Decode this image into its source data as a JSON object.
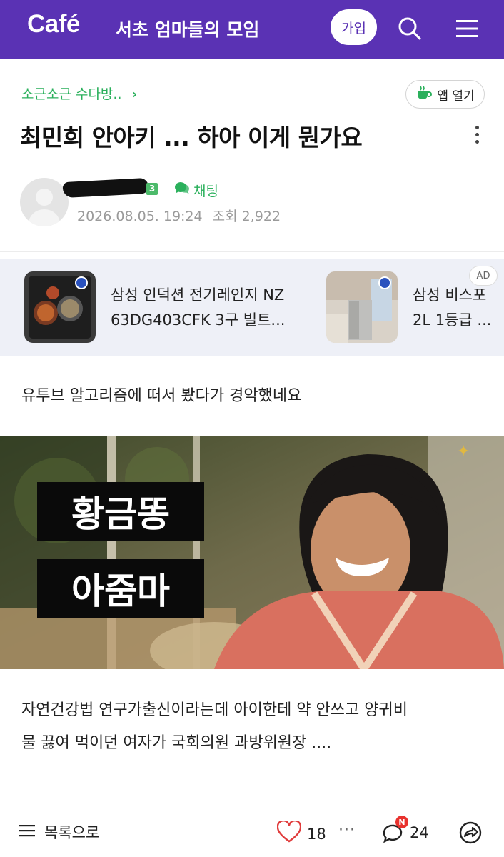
{
  "header": {
    "logo": "Café",
    "cafe_name": "서초 엄마들의 모임",
    "join_label": "가입",
    "brand_color": "#5a32b4"
  },
  "article": {
    "board": "소근소근 수다방..",
    "open_app_label": "앱 열기",
    "title": "최민희 안아키 ... 하아 이게 뭔가요",
    "author_level": "3",
    "chat_label": "채팅",
    "date": "2026.08.05. 19:24",
    "views": "조회 2,922"
  },
  "ad": {
    "badge": "AD",
    "items": [
      {
        "line1": "삼성 인덕션 전기레인지 NZ",
        "line2": "63DG403CFK 3구 빌트..."
      },
      {
        "line1": "삼성 비스포",
        "line2": "2L 1등급 ..."
      }
    ]
  },
  "content": {
    "paragraph1": "유투브 알고리즘에 떠서 봤다가 경악했네요",
    "image_caption_line1": "황금똥",
    "image_caption_line2": "아줌마",
    "paragraph2_line1": "자연건강법 연구가출신이라는데 아이한테 약 안쓰고 양귀비",
    "paragraph2_line2": "물 끓여 먹이던 여자가 국회의원 과방위원장 ...."
  },
  "bottom_bar": {
    "list_label": "목록으로",
    "likes": "18",
    "more": "···",
    "comment_badge": "N",
    "comments": "24"
  },
  "icons": [
    "search-icon",
    "menu-icon",
    "cup-icon",
    "chat-icon",
    "kebab-icon",
    "list-icon",
    "heart-icon",
    "comment-icon",
    "share-icon",
    "chevron-right-icon"
  ]
}
